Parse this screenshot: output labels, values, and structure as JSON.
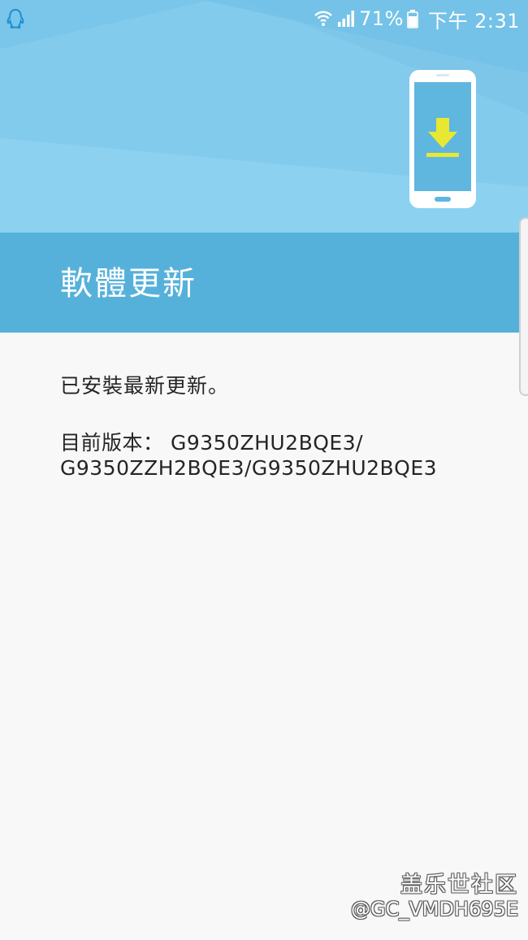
{
  "status_bar": {
    "battery_percent": "71%",
    "time": "下午 2:31",
    "notification_icon": "qq-penguin-icon",
    "wifi_icon": "wifi-icon",
    "signal_icon": "signal-icon",
    "battery_icon": "battery-icon"
  },
  "header": {
    "illustration": "phone-download-icon",
    "title": "軟體更新"
  },
  "content": {
    "status_message": "已安裝最新更新。",
    "version_line_1": "目前版本： G9350ZHU2BQE3/",
    "version_line_2": "G9350ZZH2BQE3/G9350ZHU2BQE3"
  },
  "watermark": {
    "site": "盖乐世社区",
    "user": "@GC_VMDH695E"
  },
  "colors": {
    "hero_bg": "#7cc7ea",
    "title_band": "#56b1da",
    "content_bg": "#f8f8f8",
    "download_arrow": "#e8e832"
  }
}
